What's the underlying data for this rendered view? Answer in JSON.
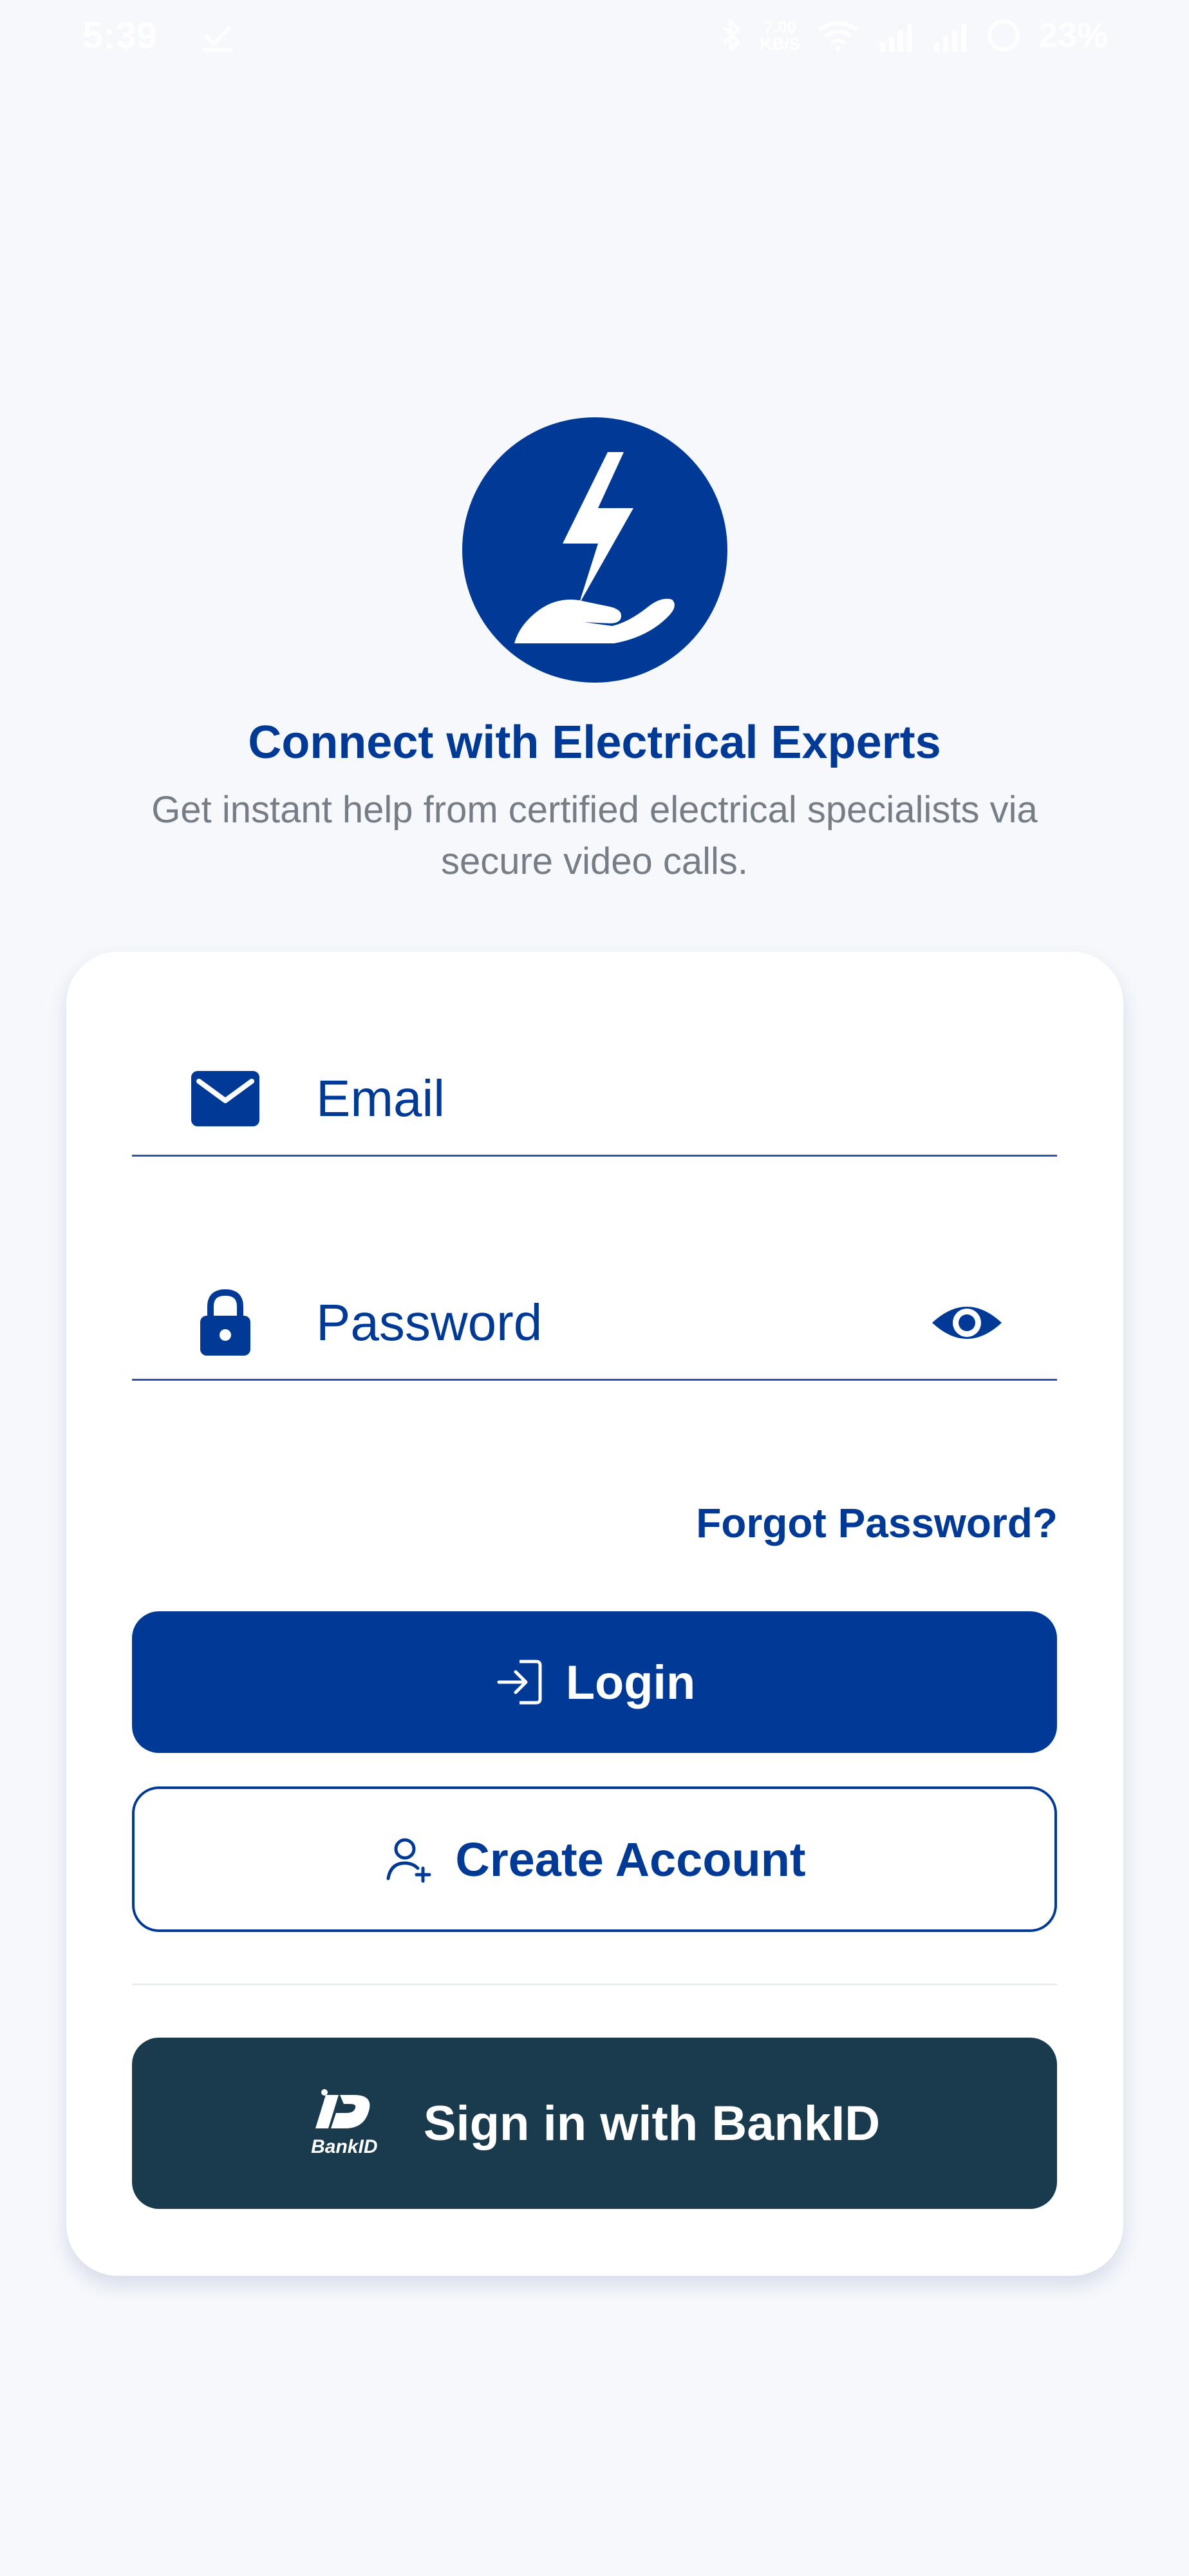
{
  "status_bar": {
    "time": "5:39",
    "speed_value": "7.00",
    "speed_unit": "KB/S",
    "battery": "23%"
  },
  "logo": {
    "icon": "lightning-hand-icon",
    "background_color": "#003a96"
  },
  "header": {
    "title": "Connect with Electrical Experts",
    "subtitle": "Get instant help from certified electrical specialists via secure video calls."
  },
  "form": {
    "email": {
      "icon": "mail-icon",
      "placeholder": "Email"
    },
    "password": {
      "icon": "lock-icon",
      "placeholder": "Password",
      "toggle_icon": "eye-icon"
    },
    "forgot_label": "Forgot Password?"
  },
  "buttons": {
    "login_label": "Login",
    "login_icon": "login-icon",
    "create_account_label": "Create Account",
    "create_account_icon": "user-add-icon",
    "bankid_label": "Sign in with BankID",
    "bankid_badge_text": "BankID",
    "bankid_icon": "bankid-logo-icon"
  },
  "colors": {
    "primary": "#003a96",
    "bankid": "#1a3b4e",
    "background": "#f6f8fc",
    "muted_text": "#777d86"
  }
}
